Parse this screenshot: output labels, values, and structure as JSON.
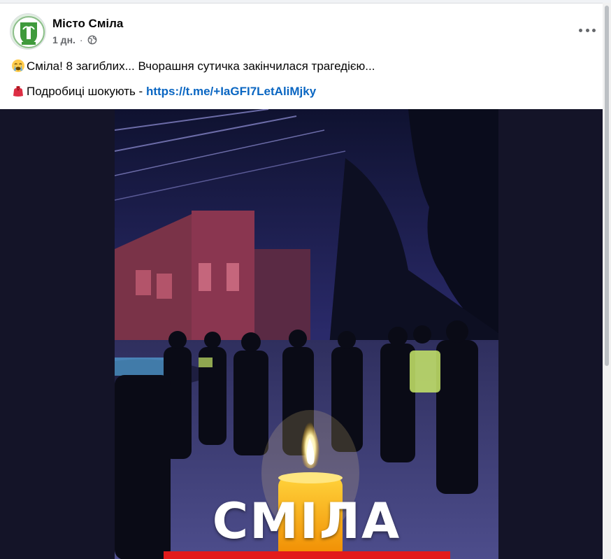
{
  "post": {
    "page_name": "Місто Сміла",
    "time": "1 дн.",
    "separator": "·",
    "privacy_icon": "globe-icon",
    "avatar_icon": "city-coat-of-arms-icon",
    "more_icon": "more-options-icon",
    "line1": {
      "emoji": "crying-face-emoji",
      "text": "Сміла! 8 загиблих... Вчорашня сутичка закінчилася трагедією..."
    },
    "line2": {
      "emoji": "red-bag-emoji",
      "text": "Подробиці шокують - ",
      "link": "https://t.me/+IaGFI7LetAliMjky"
    }
  },
  "media": {
    "description_icon": "night-street-police-candle-photo",
    "overlay_title": "СМІЛА"
  },
  "colors": {
    "link": "#0a66c2",
    "secondary_text": "#65676b",
    "media_bg": "#141428"
  }
}
